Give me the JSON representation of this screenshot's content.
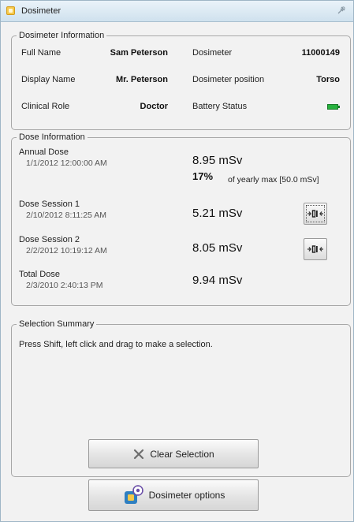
{
  "window": {
    "title": "Dosimeter"
  },
  "dosimeter_info": {
    "legend": "Dosimeter Information",
    "full_name_label": "Full Name",
    "full_name_value": "Sam Peterson",
    "display_name_label": "Display Name",
    "display_name_value": "Mr. Peterson",
    "clinical_role_label": "Clinical Role",
    "clinical_role_value": "Doctor",
    "dosimeter_label": "Dosimeter",
    "dosimeter_value": "11000149",
    "position_label": "Dosimeter position",
    "position_value": "Torso",
    "battery_label": "Battery Status",
    "battery_icon": "battery-full-icon",
    "battery_color": "#27b23e"
  },
  "dose_info": {
    "legend": "Dose Information",
    "annual": {
      "label": "Annual Dose",
      "date": "1/1/2012 12:00:00 AM",
      "value": "8.95 mSv",
      "percent": "17%",
      "percent_note": "of yearly max [50.0 mSv]"
    },
    "session1": {
      "label": "Dose Session 1",
      "date": "2/10/2012 8:11:25 AM",
      "value": "5.21 mSv",
      "button_icon": "dosimeter-signal-icon"
    },
    "session2": {
      "label": "Dose Session 2",
      "date": "2/2/2012 10:19:12 AM",
      "value": "8.05 mSv",
      "button_icon": "dosimeter-signal-icon"
    },
    "total": {
      "label": "Total Dose",
      "date": "2/3/2010 2:40:13 PM",
      "value": "9.94 mSv"
    }
  },
  "selection_summary": {
    "legend": "Selection Summary",
    "instructions": "Press Shift, left click and drag to make a selection.",
    "clear_button_label": "Clear Selection",
    "clear_icon": "close-x-icon"
  },
  "footer": {
    "options_button_label": "Dosimeter options",
    "options_icon": "dosimeter-gear-icon"
  }
}
